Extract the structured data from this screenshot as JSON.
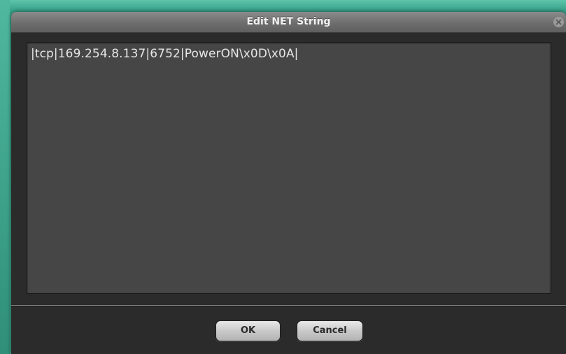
{
  "dialog": {
    "title": "Edit NET String",
    "close_icon": "close-icon",
    "editor_value": "|tcp|169.254.8.137|6752|PowerON\\x0D\\x0A|",
    "buttons": {
      "ok_label": "OK",
      "cancel_label": "Cancel"
    }
  },
  "colors": {
    "background_accent": "#3aa48c",
    "dialog_bg": "#2b2b2b",
    "editor_bg": "#464646",
    "titlebar": "#6e6e6e"
  }
}
